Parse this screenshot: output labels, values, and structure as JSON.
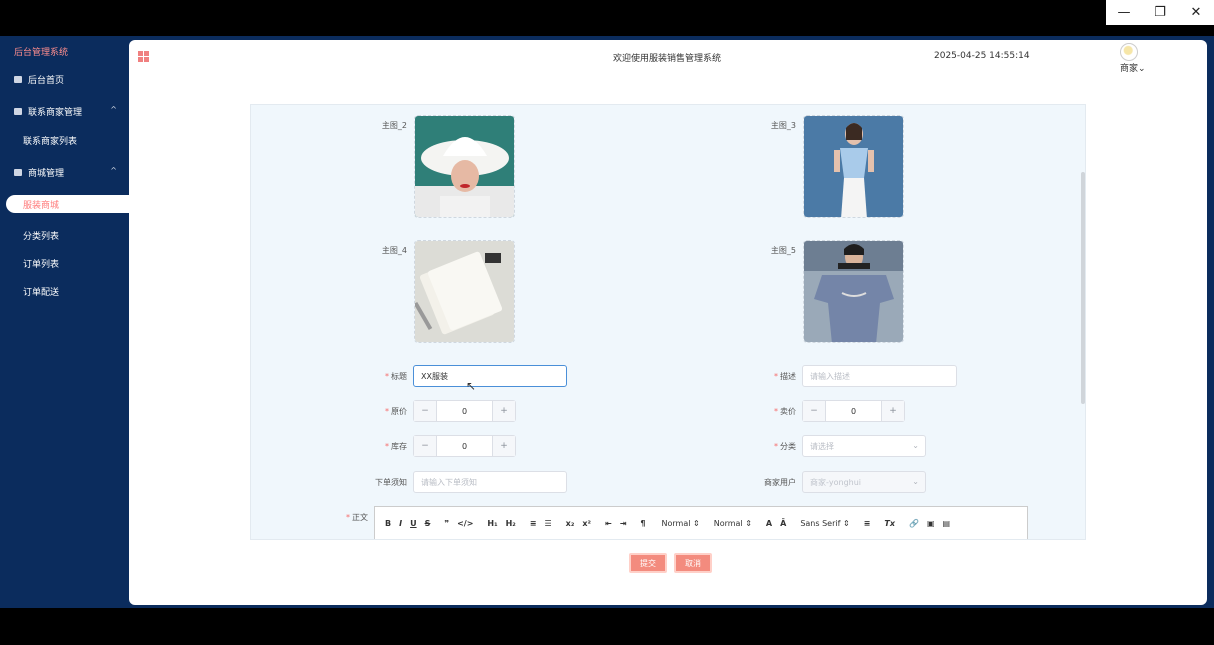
{
  "window": {
    "minimize": "—",
    "restore": "❐",
    "close": "✕"
  },
  "sidebar": {
    "title": "后台管理系统",
    "items": [
      {
        "label": "后台首页"
      },
      {
        "label": "联系商家管理"
      },
      {
        "label": "联系商家列表"
      },
      {
        "label": "商城管理"
      },
      {
        "label": "服装商城"
      },
      {
        "label": "分类列表"
      },
      {
        "label": "订单列表"
      },
      {
        "label": "订单配送"
      }
    ]
  },
  "header": {
    "welcome": "欢迎使用服装销售管理系统",
    "datetime": "2025-04-25 14:55:14",
    "user": "商家"
  },
  "form": {
    "images": [
      {
        "label": "主图_2"
      },
      {
        "label": "主图_3"
      },
      {
        "label": "主图_4"
      },
      {
        "label": "主图_5"
      }
    ],
    "title": {
      "label": "标题",
      "value": "XX服装"
    },
    "description": {
      "label": "描述",
      "placeholder": "请输入描述"
    },
    "original_price": {
      "label": "原价",
      "value": "0"
    },
    "sale_price": {
      "label": "卖价",
      "value": "0"
    },
    "stock": {
      "label": "库存",
      "value": "0"
    },
    "category": {
      "label": "分类",
      "placeholder": "请选择"
    },
    "order_note": {
      "label": "下单须知",
      "placeholder": "请输入下单须知"
    },
    "merchant_user": {
      "label": "商家用户",
      "value": "商家-yonghui"
    },
    "body": {
      "label": "正文"
    }
  },
  "editor": {
    "tools": [
      "B",
      "I",
      "U",
      "S",
      "❞",
      "</>",
      "H₁",
      "H₂",
      "≡",
      "☰",
      "x₂",
      "x²",
      "⇤",
      "⇥",
      "¶"
    ],
    "size_select": "Normal",
    "header_select": "Normal",
    "font_select": "Sans Serif",
    "tools2": [
      "A",
      "Ā",
      "≡",
      "Tx",
      "🔗",
      "▣",
      "▤"
    ]
  },
  "buttons": {
    "submit": "提交",
    "cancel": "取消"
  },
  "colors": {
    "sidebar": "#0b2c5d",
    "accent": "#f38b7e",
    "title": "#ff8e8e"
  }
}
